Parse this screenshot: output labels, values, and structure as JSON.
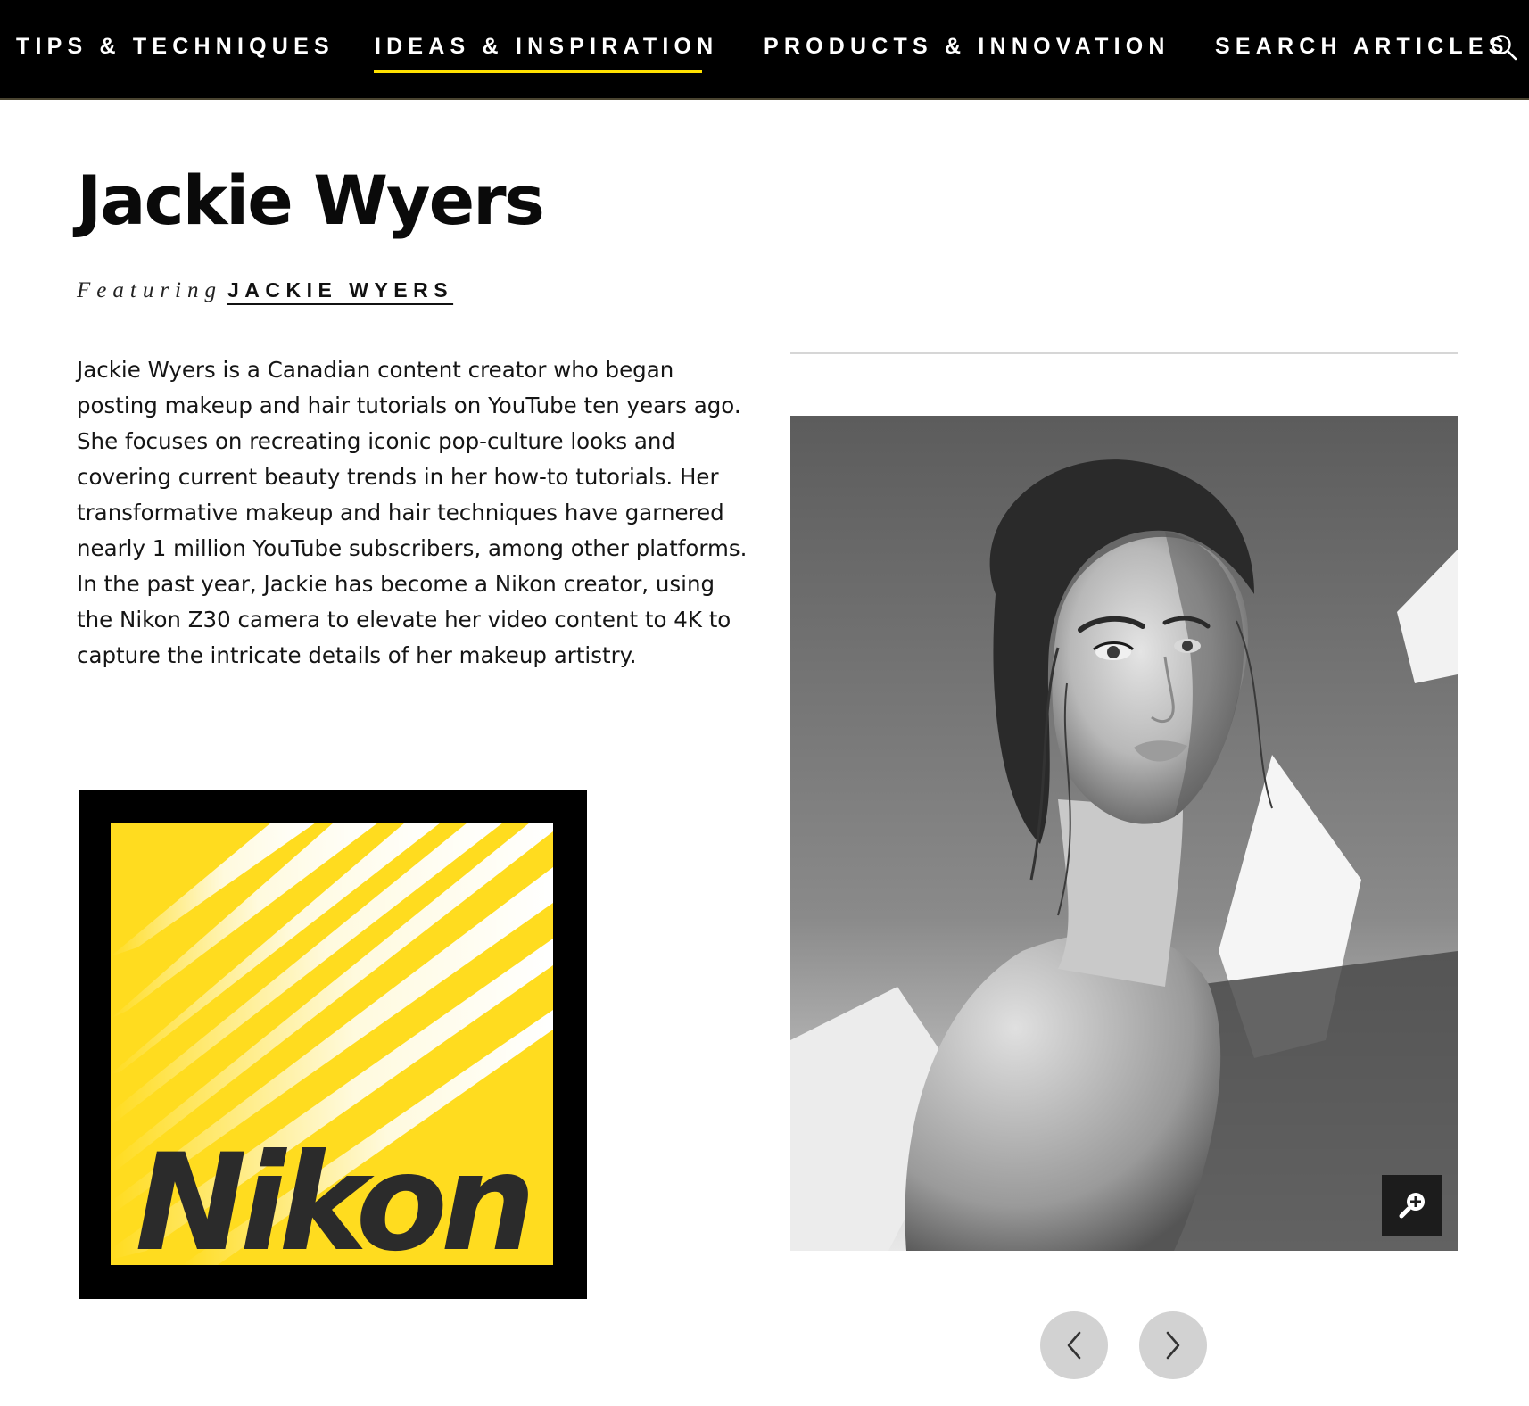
{
  "nav": {
    "items": [
      {
        "label": "TIPS & TECHNIQUES",
        "active": false
      },
      {
        "label": "IDEAS & INSPIRATION",
        "active": true
      },
      {
        "label": "PRODUCTS & INNOVATION",
        "active": false
      },
      {
        "label": "SEARCH ARTICLES",
        "active": false
      }
    ],
    "active_underline_color": "#ffe100",
    "search_icon": "search-icon"
  },
  "article": {
    "title": "Jackie Wyers",
    "byline_prefix": "Featuring",
    "byline_name": "JACKIE WYERS",
    "bio": "Jackie Wyers is a Canadian content creator who began posting makeup and hair tutorials on YouTube ten years ago. She focuses on recreating iconic pop-culture looks and covering current beauty trends in her how-to tutorials. Her transformative makeup and hair techniques have garnered nearly 1 million YouTube subscribers, among other platforms. In the past year, Jackie has become a Nikon creator, using the Nikon Z30 camera to elevate her video content to 4K to capture the intricate details of her makeup artistry."
  },
  "logo": {
    "wordmark": "Nikon",
    "colors": {
      "frame": "#000000",
      "yellow": "#ffdc1f",
      "text": "#2b2b2b"
    }
  },
  "gallery": {
    "photo_icon": "portrait-photo",
    "zoom_icon": "zoom-in-icon",
    "prev_icon": "chevron-left-icon",
    "next_icon": "chevron-right-icon"
  }
}
